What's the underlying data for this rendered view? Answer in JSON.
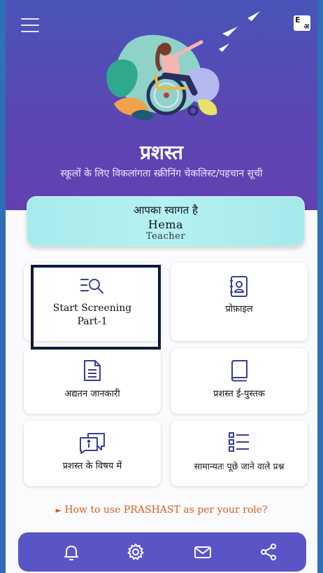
{
  "header": {
    "menu_icon": "hamburger-menu-icon",
    "language_toggle": {
      "english": "E",
      "hindi": "अ"
    }
  },
  "app": {
    "title": "प्रशस्त",
    "subtitle": "स्कूलों के लिए विकलांगता स्क्रीनिंग चेकलिस्ट/पहचान सूची"
  },
  "welcome": {
    "greeting": "आपका स्वागत है",
    "name": "Hema",
    "role": "Teacher"
  },
  "tiles": [
    {
      "label_line1": "Start Screening",
      "label_line2": "Part-1",
      "icon": "search-list-icon"
    },
    {
      "label": "प्रोफ़ाइल",
      "icon": "profile-icon"
    },
    {
      "label": "अद्यतन जानकारी",
      "icon": "document-icon"
    },
    {
      "label": "प्रशस्त ई-पुस्तक",
      "icon": "book-icon"
    },
    {
      "label": "प्रशस्त के विषय में",
      "icon": "info-chat-icon"
    },
    {
      "label": "सामान्यतः पूछे जाने वाले प्रश्न",
      "icon": "faq-list-icon"
    }
  ],
  "howto": {
    "marker": "►",
    "text": "How to use PRASHAST as per your role?"
  },
  "bottom_nav": [
    "bell-icon",
    "gear-icon",
    "mail-icon",
    "share-icon"
  ],
  "colors": {
    "hero": "#5a4bb6",
    "welcome_card": "#aeeded",
    "accent_text": "#d95c1e",
    "nav_bar": "#5a55c6",
    "icon": "#3a3f8f"
  }
}
